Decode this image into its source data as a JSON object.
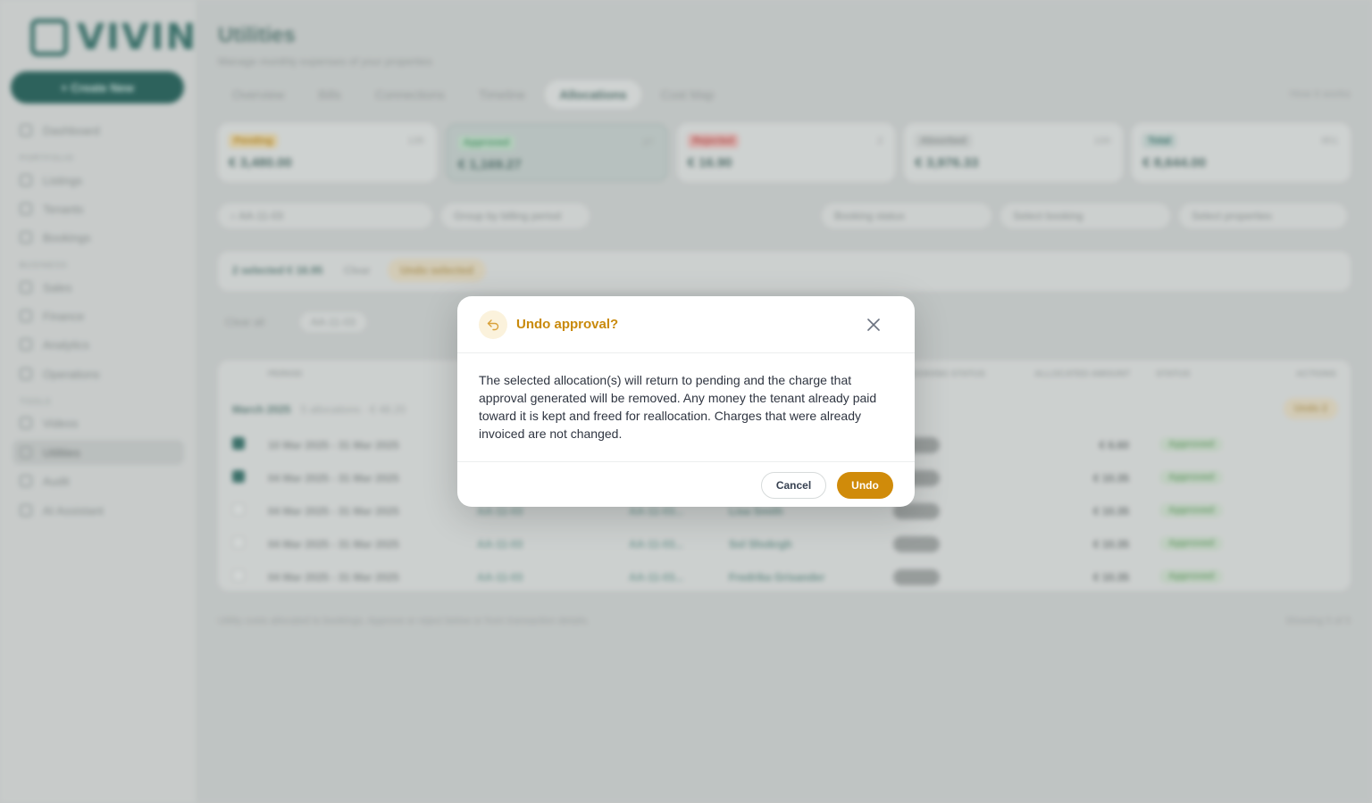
{
  "sidebar": {
    "logo_text": "VIVIN",
    "create_label": "+ Create New",
    "sections": [
      "PORTFOLIO",
      "BUSINESS",
      "TOOLS"
    ],
    "items": [
      {
        "label": "Dashboard",
        "icon": "dashboard-icon"
      },
      {
        "label": "Listings",
        "icon": "listings-icon"
      },
      {
        "label": "Tenants",
        "icon": "tenants-icon"
      },
      {
        "label": "Bookings",
        "icon": "bookings-icon"
      },
      {
        "label": "Sales",
        "icon": "sales-icon"
      },
      {
        "label": "Finance",
        "icon": "finance-icon"
      },
      {
        "label": "Analytics",
        "icon": "analytics-icon"
      },
      {
        "label": "Operations",
        "icon": "operations-icon"
      },
      {
        "label": "Videos",
        "icon": "videos-icon"
      },
      {
        "label": "Utilities",
        "icon": "utilities-icon",
        "active": true
      },
      {
        "label": "Audit",
        "icon": "audit-icon"
      },
      {
        "label": "AI Assistant",
        "icon": "ai-assistant-icon"
      }
    ]
  },
  "page": {
    "title": "Utilities",
    "subtitle": "Manage monthly expenses of your properties",
    "help": "How it works",
    "tabs": [
      "Overview",
      "Bills",
      "Connections",
      "Timeline",
      "Allocations",
      "Cost Map"
    ],
    "active_tab": "Allocations"
  },
  "cards": [
    {
      "label": "Pending",
      "count": "135",
      "amount": "€ 3,480.00",
      "color": "#d9a13a"
    },
    {
      "label": "Approved",
      "count": "27",
      "amount": "€ 1,169.27",
      "color": "#4c9a6a"
    },
    {
      "label": "Rejected",
      "count": "2",
      "amount": "€ 16.90",
      "color": "#c0504d"
    },
    {
      "label": "Absorbed",
      "count": "100",
      "amount": "€ 3,976.33",
      "color": "#8c9392"
    },
    {
      "label": "Total",
      "count": "851",
      "amount": "€ 8,644.00",
      "color": "#2f6e66"
    }
  ],
  "filters": {
    "search_value": "AA-11-03",
    "group_by": "Group by billing period",
    "booking_status": "Booking status",
    "select_booking": "Select booking",
    "select_properties": "Select properties"
  },
  "selection": {
    "summary": "2 selected  € 16.95",
    "clear": "Clear",
    "undo_selected": "Undo selected"
  },
  "chips": {
    "clear_all": "Clear all",
    "active": "AA-11-03"
  },
  "table": {
    "headers": [
      "PERIOD",
      "BOOKING STATUS",
      "ALLOCATED AMOUNT",
      "STATUS",
      "ACTIONS"
    ],
    "group_label": "March 2025",
    "group_meta": "5 allocations · € 48.20",
    "undo_group": "Undo 2",
    "rows": [
      {
        "period": "10 Mar 2025 - 31 Mar 2025",
        "checked": true,
        "unit": "",
        "booking": "",
        "tenant": "",
        "amount": "€ 6.60",
        "status": "Approved"
      },
      {
        "period": "04 Mar 2025 - 31 Mar 2025",
        "checked": true,
        "unit": "",
        "booking": "",
        "tenant": "",
        "amount": "€ 10.35",
        "status": "Approved"
      },
      {
        "period": "04 Mar 2025 - 31 Mar 2025",
        "checked": false,
        "unit": "AA-11-03",
        "booking": "AA-11-03...",
        "tenant": "Lisa Smith",
        "amount": "€ 10.35",
        "status": "Approved"
      },
      {
        "period": "04 Mar 2025 - 31 Mar 2025",
        "checked": false,
        "unit": "AA-11-03",
        "booking": "AA-11-03...",
        "tenant": "Sol Shokrgh",
        "amount": "€ 10.35",
        "status": "Approved"
      },
      {
        "period": "04 Mar 2025 - 31 Mar 2025",
        "checked": false,
        "unit": "AA-11-03",
        "booking": "AA-11-03...",
        "tenant": "Fredrika Grisander",
        "amount": "€ 10.35",
        "status": "Approved"
      }
    ]
  },
  "footer": {
    "left": "Utility costs allocated to bookings. Approve or reject below or from transaction details.",
    "right": "Showing 5 of 5"
  },
  "modal": {
    "title": "Undo approval?",
    "icon": "undo-arrow-icon",
    "body": "The selected allocation(s) will return to pending and the charge that approval generated will be removed. Any money the tenant already paid toward it is kept and freed for reallocation. Charges that were already invoiced are not changed.",
    "cancel_label": "Cancel",
    "confirm_label": "Undo",
    "accent_color": "#d08b0a"
  }
}
